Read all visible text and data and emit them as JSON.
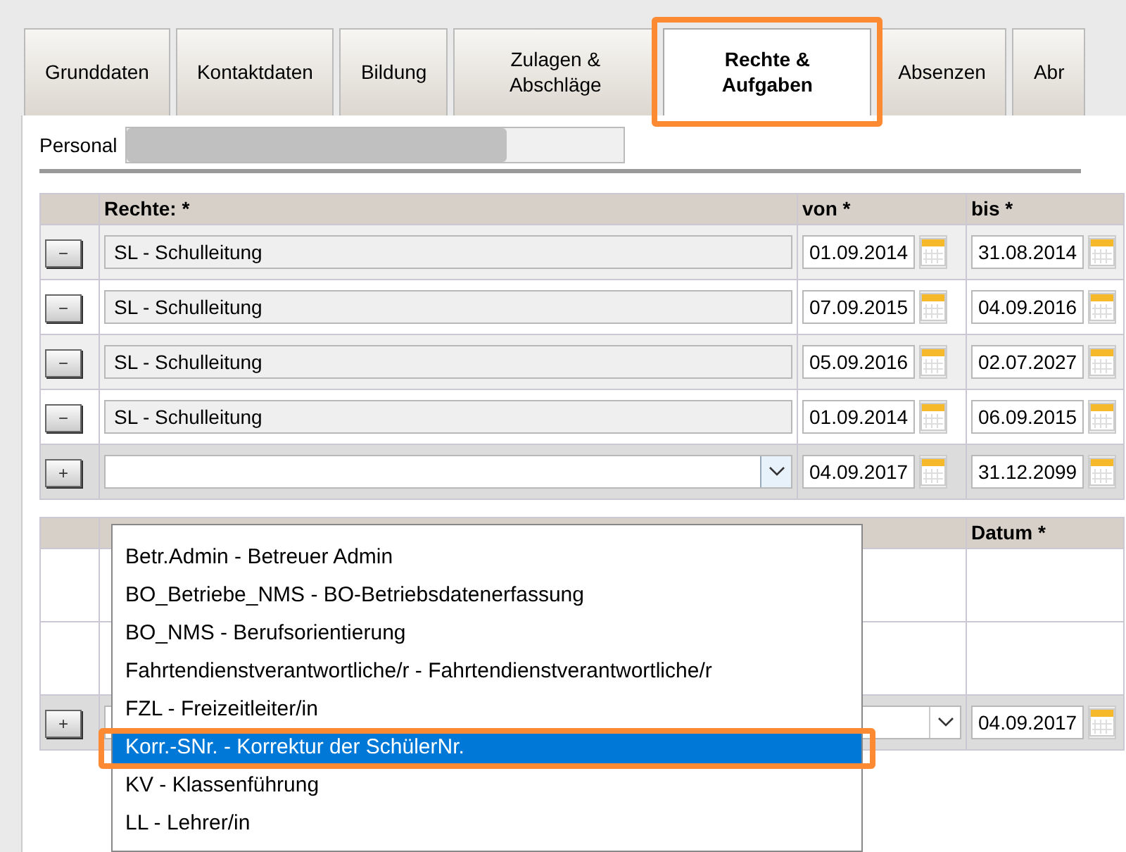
{
  "tabs": [
    {
      "label": "Grunddaten",
      "selected": false,
      "highlighted": false
    },
    {
      "label": "Kontaktdaten",
      "selected": false,
      "highlighted": false
    },
    {
      "label": "Bildung",
      "selected": false,
      "highlighted": false
    },
    {
      "label": "Zulagen & Abschläge",
      "selected": false,
      "highlighted": false
    },
    {
      "label": "Rechte & Aufgaben",
      "selected": true,
      "highlighted": true
    },
    {
      "label": "Absenzen",
      "selected": false,
      "highlighted": false
    },
    {
      "label": "Abr",
      "selected": false,
      "highlighted": false
    }
  ],
  "personal": {
    "label": "Personal"
  },
  "rights_table": {
    "columns": [
      "Rechte: *",
      "von *",
      "bis *"
    ],
    "rows": [
      {
        "action": "−",
        "right": "SL - Schulleitung",
        "from": "01.09.2014",
        "to": "31.08.2014"
      },
      {
        "action": "−",
        "right": "SL - Schulleitung",
        "from": "07.09.2015",
        "to": "04.09.2016"
      },
      {
        "action": "−",
        "right": "SL - Schulleitung",
        "from": "05.09.2016",
        "to": "02.07.2027"
      },
      {
        "action": "−",
        "right": "SL - Schulleitung",
        "from": "01.09.2014",
        "to": "06.09.2015"
      }
    ],
    "new_row": {
      "action": "+",
      "from": "04.09.2017",
      "to": "31.12.2099"
    }
  },
  "dropdown": {
    "options": [
      {
        "label": "Betr.Admin - Betreuer Admin",
        "selected": false,
        "highlighted": false
      },
      {
        "label": "BO_Betriebe_NMS - BO-Betriebsdatenerfassung",
        "selected": false,
        "highlighted": false
      },
      {
        "label": "BO_NMS - Berufsorientierung",
        "selected": false,
        "highlighted": false
      },
      {
        "label": "Fahrtendienstverantwortliche/r - Fahrtendienstverantwortliche/r",
        "selected": false,
        "highlighted": false
      },
      {
        "label": "FZL - Freizeitleiter/in",
        "selected": false,
        "highlighted": false
      },
      {
        "label": "Korr.-SNr. - Korrektur der SchülerNr.",
        "selected": true,
        "highlighted": true
      },
      {
        "label": "KV - Klassenführung",
        "selected": false,
        "highlighted": false
      },
      {
        "label": "LL - Lehrer/in",
        "selected": false,
        "highlighted": false
      }
    ]
  },
  "tasks_table": {
    "columns": [
      "Datum *"
    ],
    "new_row": {
      "action": "+",
      "date": "04.09.2017"
    }
  }
}
